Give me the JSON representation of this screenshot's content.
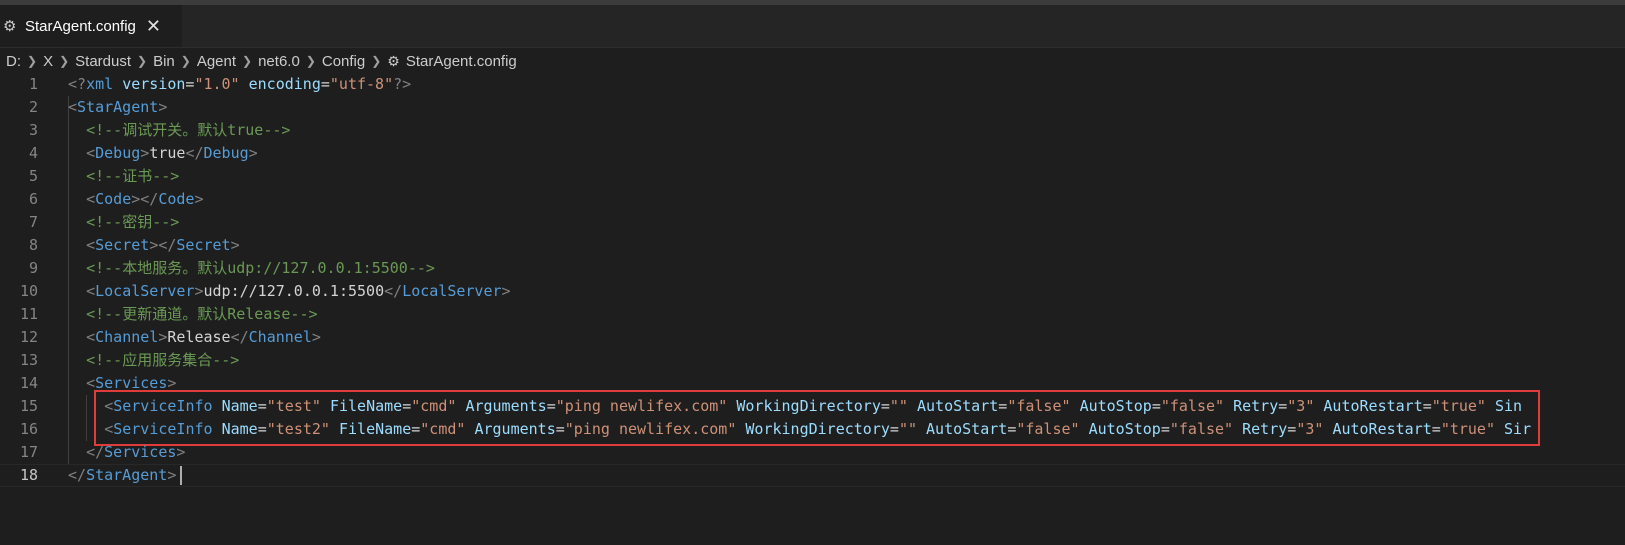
{
  "tab": {
    "label": "StarAgent.config",
    "close": "✕",
    "icon": "gear-icon"
  },
  "breadcrumb": [
    "D:",
    "X",
    "Stardust",
    "Bin",
    "Agent",
    "net6.0",
    "Config"
  ],
  "breadcrumb_file": "StarAgent.config",
  "editor": {
    "active_line": 18,
    "lines": [
      {
        "n": "1",
        "indent": 0,
        "tokens": [
          [
            "br",
            "<?"
          ],
          [
            "tag",
            "xml"
          ],
          [
            "txt",
            " "
          ],
          [
            "attr",
            "version"
          ],
          [
            "txt",
            "="
          ],
          [
            "str",
            "\"1.0\""
          ],
          [
            "txt",
            " "
          ],
          [
            "attr",
            "encoding"
          ],
          [
            "txt",
            "="
          ],
          [
            "str",
            "\"utf-8\""
          ],
          [
            "br",
            "?>"
          ]
        ]
      },
      {
        "n": "2",
        "indent": 0,
        "tokens": [
          [
            "br",
            "<"
          ],
          [
            "tag",
            "StarAgent"
          ],
          [
            "br",
            ">"
          ]
        ]
      },
      {
        "n": "3",
        "indent": 1,
        "tokens": [
          [
            "cmt",
            "<!--调试开关。默认true-->"
          ]
        ]
      },
      {
        "n": "4",
        "indent": 1,
        "tokens": [
          [
            "br",
            "<"
          ],
          [
            "tag",
            "Debug"
          ],
          [
            "br",
            ">"
          ],
          [
            "txt",
            "true"
          ],
          [
            "br",
            "</"
          ],
          [
            "tag",
            "Debug"
          ],
          [
            "br",
            ">"
          ]
        ]
      },
      {
        "n": "5",
        "indent": 1,
        "tokens": [
          [
            "cmt",
            "<!--证书-->"
          ]
        ]
      },
      {
        "n": "6",
        "indent": 1,
        "tokens": [
          [
            "br",
            "<"
          ],
          [
            "tag",
            "Code"
          ],
          [
            "br",
            "></"
          ],
          [
            "tag",
            "Code"
          ],
          [
            "br",
            ">"
          ]
        ]
      },
      {
        "n": "7",
        "indent": 1,
        "tokens": [
          [
            "cmt",
            "<!--密钥-->"
          ]
        ]
      },
      {
        "n": "8",
        "indent": 1,
        "tokens": [
          [
            "br",
            "<"
          ],
          [
            "tag",
            "Secret"
          ],
          [
            "br",
            "></"
          ],
          [
            "tag",
            "Secret"
          ],
          [
            "br",
            ">"
          ]
        ]
      },
      {
        "n": "9",
        "indent": 1,
        "tokens": [
          [
            "cmt",
            "<!--本地服务。默认udp://127.0.0.1:5500-->"
          ]
        ]
      },
      {
        "n": "10",
        "indent": 1,
        "tokens": [
          [
            "br",
            "<"
          ],
          [
            "tag",
            "LocalServer"
          ],
          [
            "br",
            ">"
          ],
          [
            "txt",
            "udp://127.0.0.1:5500"
          ],
          [
            "br",
            "</"
          ],
          [
            "tag",
            "LocalServer"
          ],
          [
            "br",
            ">"
          ]
        ]
      },
      {
        "n": "11",
        "indent": 1,
        "tokens": [
          [
            "cmt",
            "<!--更新通道。默认Release-->"
          ]
        ]
      },
      {
        "n": "12",
        "indent": 1,
        "tokens": [
          [
            "br",
            "<"
          ],
          [
            "tag",
            "Channel"
          ],
          [
            "br",
            ">"
          ],
          [
            "txt",
            "Release"
          ],
          [
            "br",
            "</"
          ],
          [
            "tag",
            "Channel"
          ],
          [
            "br",
            ">"
          ]
        ]
      },
      {
        "n": "13",
        "indent": 1,
        "tokens": [
          [
            "cmt",
            "<!--应用服务集合-->"
          ]
        ]
      },
      {
        "n": "14",
        "indent": 1,
        "tokens": [
          [
            "br",
            "<"
          ],
          [
            "tag",
            "Services"
          ],
          [
            "br",
            ">"
          ]
        ]
      },
      {
        "n": "15",
        "indent": 2,
        "tokens": [
          [
            "br",
            "<"
          ],
          [
            "tag",
            "ServiceInfo"
          ],
          [
            "txt",
            " "
          ],
          [
            "attr",
            "Name"
          ],
          [
            "txt",
            "="
          ],
          [
            "str",
            "\"test\""
          ],
          [
            "txt",
            " "
          ],
          [
            "attr",
            "FileName"
          ],
          [
            "txt",
            "="
          ],
          [
            "str",
            "\"cmd\""
          ],
          [
            "txt",
            " "
          ],
          [
            "attr",
            "Arguments"
          ],
          [
            "txt",
            "="
          ],
          [
            "str",
            "\"ping newlifex.com\""
          ],
          [
            "txt",
            " "
          ],
          [
            "attr",
            "WorkingDirectory"
          ],
          [
            "txt",
            "="
          ],
          [
            "str",
            "\"\""
          ],
          [
            "txt",
            " "
          ],
          [
            "attr",
            "AutoStart"
          ],
          [
            "txt",
            "="
          ],
          [
            "str",
            "\"false\""
          ],
          [
            "txt",
            " "
          ],
          [
            "attr",
            "AutoStop"
          ],
          [
            "txt",
            "="
          ],
          [
            "str",
            "\"false\""
          ],
          [
            "txt",
            " "
          ],
          [
            "attr",
            "Retry"
          ],
          [
            "txt",
            "="
          ],
          [
            "str",
            "\"3\""
          ],
          [
            "txt",
            " "
          ],
          [
            "attr",
            "AutoRestart"
          ],
          [
            "txt",
            "="
          ],
          [
            "str",
            "\"true\""
          ],
          [
            "txt",
            " "
          ],
          [
            "attr",
            "Sin"
          ]
        ]
      },
      {
        "n": "16",
        "indent": 2,
        "tokens": [
          [
            "br",
            "<"
          ],
          [
            "tag",
            "ServiceInfo"
          ],
          [
            "txt",
            " "
          ],
          [
            "attr",
            "Name"
          ],
          [
            "txt",
            "="
          ],
          [
            "str",
            "\"test2\""
          ],
          [
            "txt",
            " "
          ],
          [
            "attr",
            "FileName"
          ],
          [
            "txt",
            "="
          ],
          [
            "str",
            "\"cmd\""
          ],
          [
            "txt",
            " "
          ],
          [
            "attr",
            "Arguments"
          ],
          [
            "txt",
            "="
          ],
          [
            "str",
            "\"ping newlifex.com\""
          ],
          [
            "txt",
            " "
          ],
          [
            "attr",
            "WorkingDirectory"
          ],
          [
            "txt",
            "="
          ],
          [
            "str",
            "\"\""
          ],
          [
            "txt",
            " "
          ],
          [
            "attr",
            "AutoStart"
          ],
          [
            "txt",
            "="
          ],
          [
            "str",
            "\"false\""
          ],
          [
            "txt",
            " "
          ],
          [
            "attr",
            "AutoStop"
          ],
          [
            "txt",
            "="
          ],
          [
            "str",
            "\"false\""
          ],
          [
            "txt",
            " "
          ],
          [
            "attr",
            "Retry"
          ],
          [
            "txt",
            "="
          ],
          [
            "str",
            "\"3\""
          ],
          [
            "txt",
            " "
          ],
          [
            "attr",
            "AutoRestart"
          ],
          [
            "txt",
            "="
          ],
          [
            "str",
            "\"true\""
          ],
          [
            "txt",
            " "
          ],
          [
            "attr",
            "Sir"
          ]
        ]
      },
      {
        "n": "17",
        "indent": 1,
        "tokens": [
          [
            "br",
            "</"
          ],
          [
            "tag",
            "Services"
          ],
          [
            "br",
            ">"
          ]
        ]
      },
      {
        "n": "18",
        "indent": 0,
        "tokens": [
          [
            "br",
            "</"
          ],
          [
            "tag",
            "StarAgent"
          ],
          [
            "br",
            ">"
          ]
        ]
      }
    ]
  },
  "colors": {
    "highlight_box": "#e03c3c",
    "tag": "#569cd6",
    "attr": "#9cdcfe",
    "string": "#ce9178",
    "comment": "#6a9955"
  }
}
